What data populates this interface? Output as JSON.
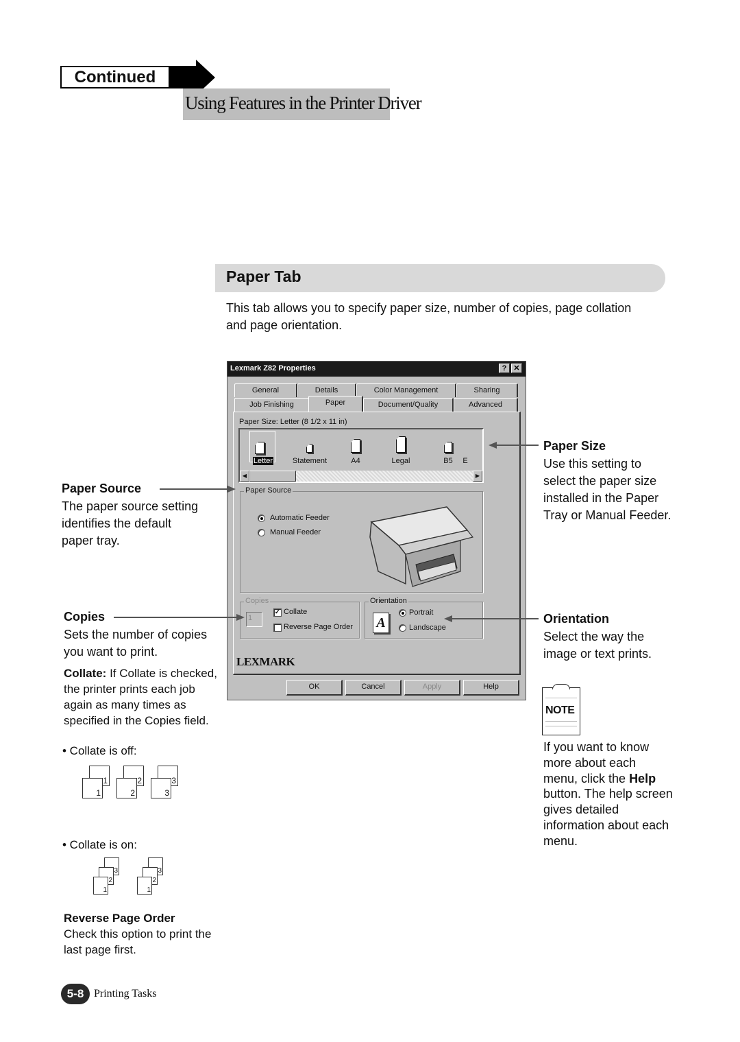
{
  "header": {
    "continued_label": "Continued",
    "section_title": "Using Features in the Printer Driver"
  },
  "paper_tab": {
    "heading": "Paper Tab",
    "intro": "This tab allows you to specify paper size, number of copies, page collation and page orientation."
  },
  "dialog": {
    "title": "Lexmark Z82 Properties",
    "help_btn": "?",
    "close_btn": "✕",
    "tabs_row1": [
      "General",
      "Details",
      "Color Management",
      "Sharing"
    ],
    "tabs_row2": [
      "Job Finishing",
      "Paper",
      "Document/Quality",
      "Advanced"
    ],
    "active_tab": "Paper",
    "paper_size_label": "Paper Size: Letter (8 1/2 x 11 in)",
    "paper_sizes": [
      "Letter",
      "Statement",
      "A4",
      "Legal",
      "B5",
      "E"
    ],
    "selected_size": "Letter",
    "paper_source": {
      "title": "Paper Source",
      "options": [
        "Automatic Feeder",
        "Manual Feeder"
      ],
      "selected": "Automatic Feeder"
    },
    "copies": {
      "title": "Copies",
      "value": "1",
      "collate_label": "Collate",
      "collate_checked": true,
      "reverse_label": "Reverse Page Order",
      "reverse_checked": false
    },
    "orientation": {
      "title": "Orientation",
      "icon_letter": "A",
      "options": [
        "Portrait",
        "Landscape"
      ],
      "selected": "Portrait"
    },
    "brand": "LEXMARK",
    "buttons": {
      "ok": "OK",
      "cancel": "Cancel",
      "apply": "Apply",
      "help": "Help"
    }
  },
  "callouts": {
    "paper_source": {
      "title": "Paper Source",
      "text": "The paper source setting identifies the default paper tray."
    },
    "copies": {
      "title": "Copies",
      "text": "Sets the number of copies you want to print."
    },
    "collate": {
      "title": "Collate:",
      "text": "If Collate is checked, the printer prints each job again as many times as specified in the Copies field.",
      "off_label": "• Collate is off:",
      "on_label": "• Collate is on:",
      "off_pages": [
        "1",
        "2",
        "3"
      ],
      "on_sets": [
        [
          "3",
          "2",
          "1"
        ],
        [
          "3",
          "2",
          "1"
        ]
      ]
    },
    "reverse": {
      "title": "Reverse Page Order",
      "text": "Check this option to print the last page first."
    },
    "paper_size": {
      "title": "Paper Size",
      "text": "Use this setting to select the paper size installed in the Paper Tray or Manual Feeder."
    },
    "orientation": {
      "title": "Orientation",
      "text": "Select the way the image or text prints."
    },
    "note": {
      "badge": "NOTE",
      "text_before": "If you want to know more about each menu, click the ",
      "bold": "Help",
      "text_after": " button. The help screen gives detailed information about each menu."
    }
  },
  "footer": {
    "page_number": "5-8",
    "chapter": "Printing Tasks"
  }
}
